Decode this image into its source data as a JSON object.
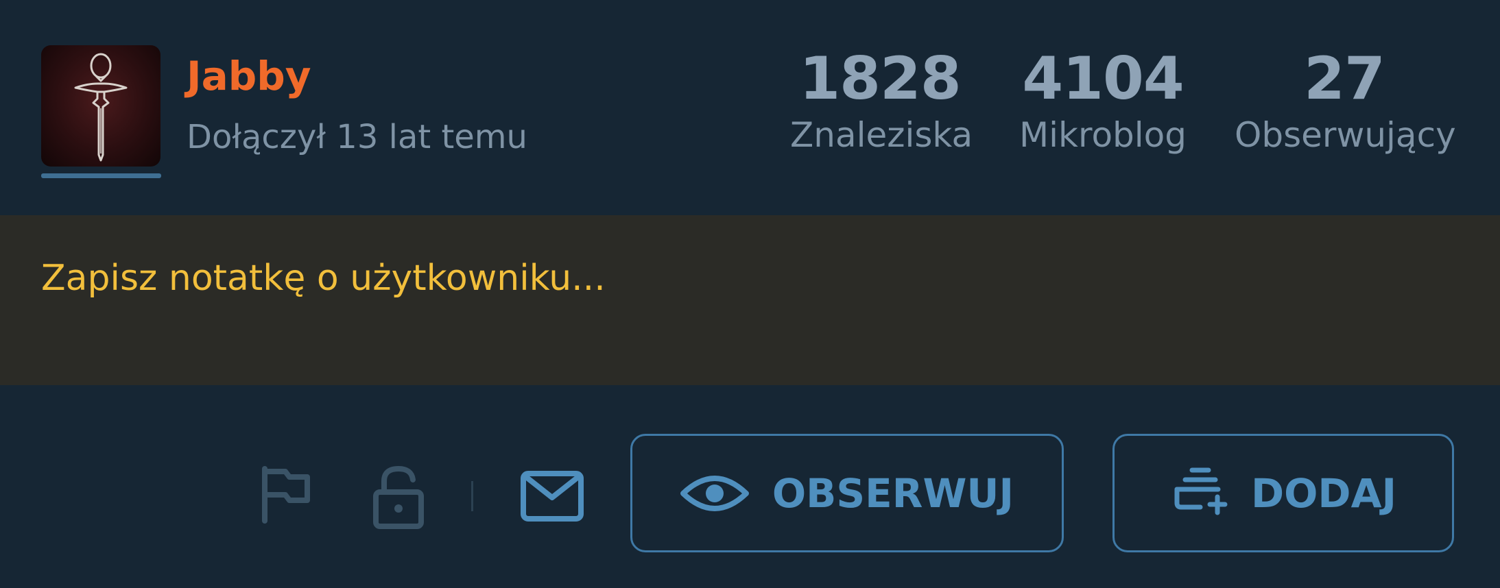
{
  "profile": {
    "username": "Jabby",
    "joined": "Dołączył 13 lat temu",
    "avatar": "ankh-sword-avatar"
  },
  "stats": [
    {
      "value": "1828",
      "label": "Znaleziska"
    },
    {
      "value": "4104",
      "label": "Mikroblog"
    },
    {
      "value": "27",
      "label": "Obserwujący"
    }
  ],
  "note": {
    "placeholder": "Zapisz notatkę o użytkowniku..."
  },
  "actions": {
    "icons": [
      "flag-icon",
      "lock-icon",
      "mail-icon"
    ],
    "follow_label": "OBSERWUJ",
    "follow_icon": "eye-icon",
    "add_label": "DODAJ",
    "add_icon": "add-to-list-icon"
  },
  "colors": {
    "username": "#f06a2a",
    "note_text": "#f2bf3c",
    "accent": "#4f8fbe",
    "background": "#162634",
    "note_background": "#2b2b26"
  }
}
